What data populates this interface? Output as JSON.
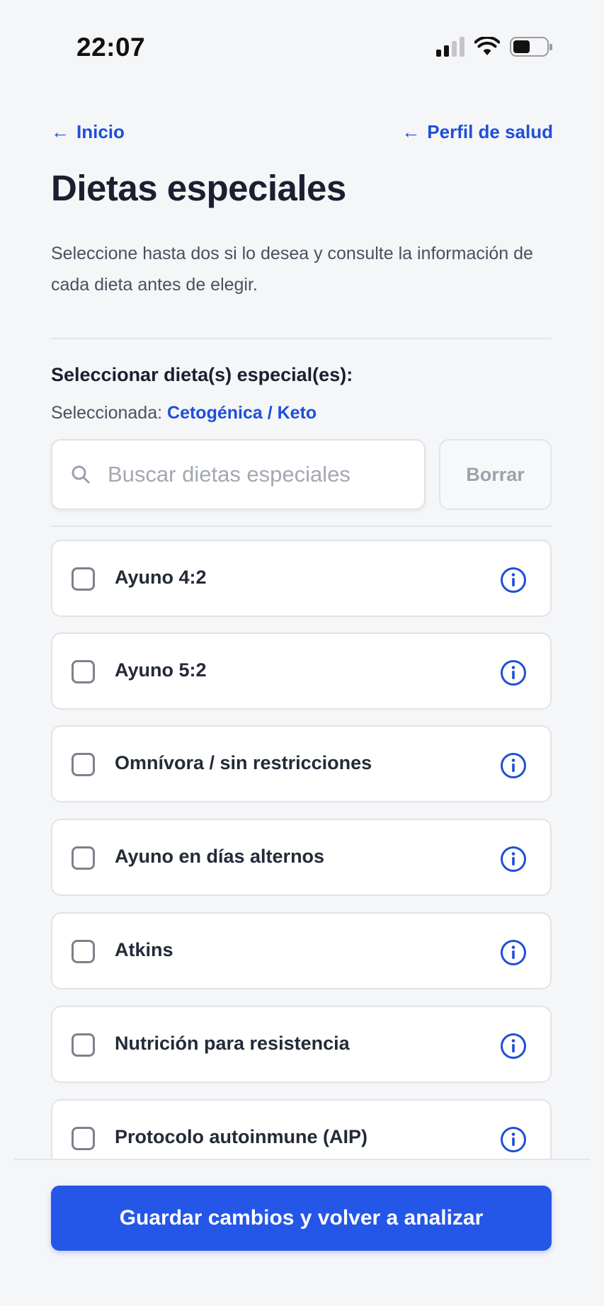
{
  "status_bar": {
    "time": "22:07",
    "icons": [
      "cellular-signal-icon",
      "wifi-icon",
      "battery-icon"
    ]
  },
  "nav": {
    "back_home": "Inicio",
    "back_profile": "Perfil de salud",
    "arrow_icon": "arrow-left-icon"
  },
  "header": {
    "title": "Dietas especiales",
    "description": "Seleccione hasta dos si lo desea y consulte la información de cada dieta antes de elegir."
  },
  "selection": {
    "label": "Seleccionar dieta(s) especial(es):",
    "selected_prefix": "Seleccionada:",
    "selected_value": "Cetogénica / Keto"
  },
  "search": {
    "placeholder": "Buscar dietas especiales",
    "value": "",
    "clear_label": "Borrar"
  },
  "diets": [
    {
      "label": "Ayuno 4:2",
      "checked": false
    },
    {
      "label": "Ayuno 5:2",
      "checked": false
    },
    {
      "label": "Omnívora / sin restricciones",
      "checked": false
    },
    {
      "label": "Ayuno en días alternos",
      "checked": false
    },
    {
      "label": "Atkins",
      "checked": false
    },
    {
      "label": "Nutrición para resistencia",
      "checked": false
    },
    {
      "label": "Protocolo autoinmune (AIP)",
      "checked": false
    }
  ],
  "footer": {
    "save_label": "Guardar cambios y volver a analizar"
  },
  "colors": {
    "accent": "#2456e8",
    "link": "#1e4fd8",
    "background": "#f5f6f8"
  }
}
